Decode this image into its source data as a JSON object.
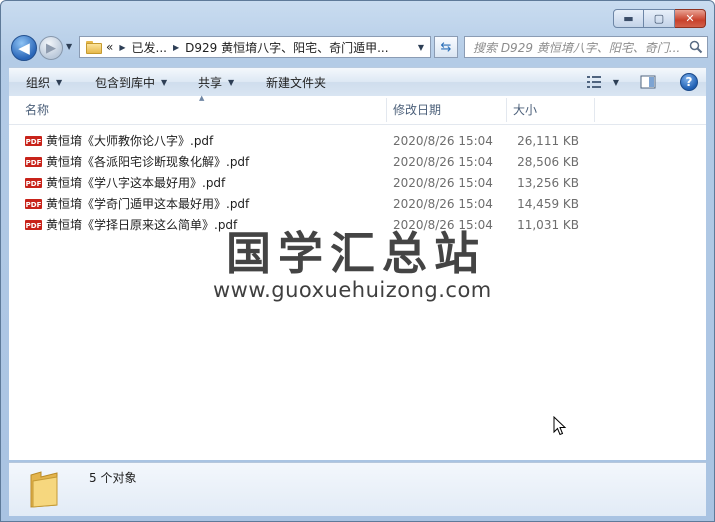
{
  "window": {
    "controls": {
      "minimize": "▬",
      "maximize": "▢",
      "close": "✕"
    }
  },
  "nav": {
    "back_glyph": "◀",
    "forward_glyph": "▶",
    "breadcrumb_overflow": "«",
    "breadcrumbs": [
      "已发...",
      "D929 黄恒堉八字、阳宅、奇门遁甲..."
    ],
    "search_placeholder": "搜索 D929 黄恒堉八字、阳宅、奇门..."
  },
  "toolbar": {
    "organize": "组织",
    "include_in_library": "包含到库中",
    "share": "共享",
    "new_folder": "新建文件夹",
    "help": "?"
  },
  "columns": {
    "name": "名称",
    "date": "修改日期",
    "size": "大小"
  },
  "files": [
    {
      "name": "黄恒堉《大师教你论八字》.pdf",
      "date": "2020/8/26 15:04",
      "size": "26,111 KB"
    },
    {
      "name": "黄恒堉《各派阳宅诊断现象化解》.pdf",
      "date": "2020/8/26 15:04",
      "size": "28,506 KB"
    },
    {
      "name": "黄恒堉《学八字这本最好用》.pdf",
      "date": "2020/8/26 15:04",
      "size": "13,256 KB"
    },
    {
      "name": "黄恒堉《学奇门遁甲这本最好用》.pdf",
      "date": "2020/8/26 15:04",
      "size": "14,459 KB"
    },
    {
      "name": "黄恒堉《学择日原来这么简单》.pdf",
      "date": "2020/8/26 15:04",
      "size": "11,031 KB"
    }
  ],
  "watermark": {
    "title": "国学汇总站",
    "url": "www.guoxuehuizong.com"
  },
  "details": {
    "count": "5 个对象"
  },
  "colors": {
    "pdf_red": "#c8231a",
    "folder_yellow": "#f1cb65",
    "frame_blue": "#b3cbe6"
  }
}
